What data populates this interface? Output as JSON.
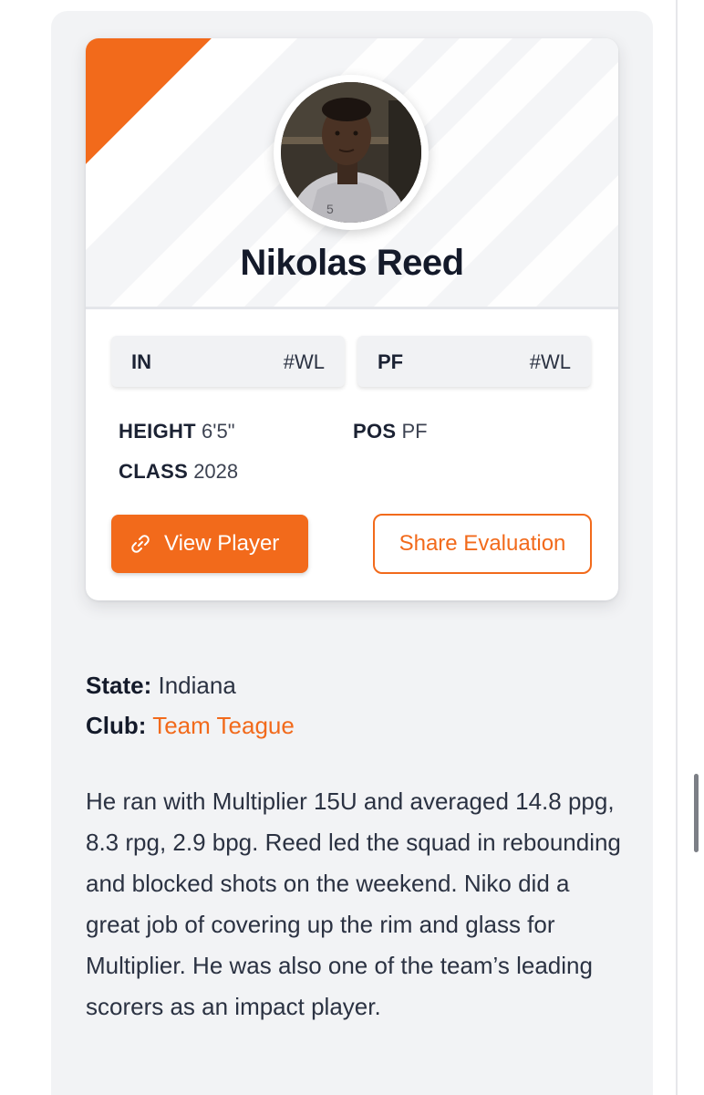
{
  "player": {
    "name": "Nikolas Reed",
    "photo_alt": "Nikolas Reed photo"
  },
  "chips": {
    "state": {
      "abbr": "IN",
      "rank": "#WL"
    },
    "position": {
      "abbr": "PF",
      "rank": "#WL"
    }
  },
  "stats": {
    "height": {
      "label": "HEIGHT",
      "value": "6'5\""
    },
    "class": {
      "label": "CLASS",
      "value": "2028"
    },
    "pos": {
      "label": "POS",
      "value": "PF"
    }
  },
  "actions": {
    "view_player": "View Player",
    "share_evaluation": "Share Evaluation"
  },
  "meta": {
    "state_label": "State:",
    "state_value": "Indiana",
    "club_label": "Club:",
    "club_value": "Team Teague"
  },
  "bio": "He ran with Multiplier 15U and averaged 14.8 ppg, 8.3 rpg, 2.9 bpg. Reed led the squad in rebounding and blocked shots on the weekend. Niko did a great job of covering up the rim and glass for Multiplier. He was also one of the team’s leading scorers as an impact player.",
  "icons": {
    "link": "link-icon"
  },
  "colors": {
    "accent": "#f26a1b",
    "heading": "#141a2a",
    "text": "#2b3242",
    "panel": "#f2f3f5"
  }
}
